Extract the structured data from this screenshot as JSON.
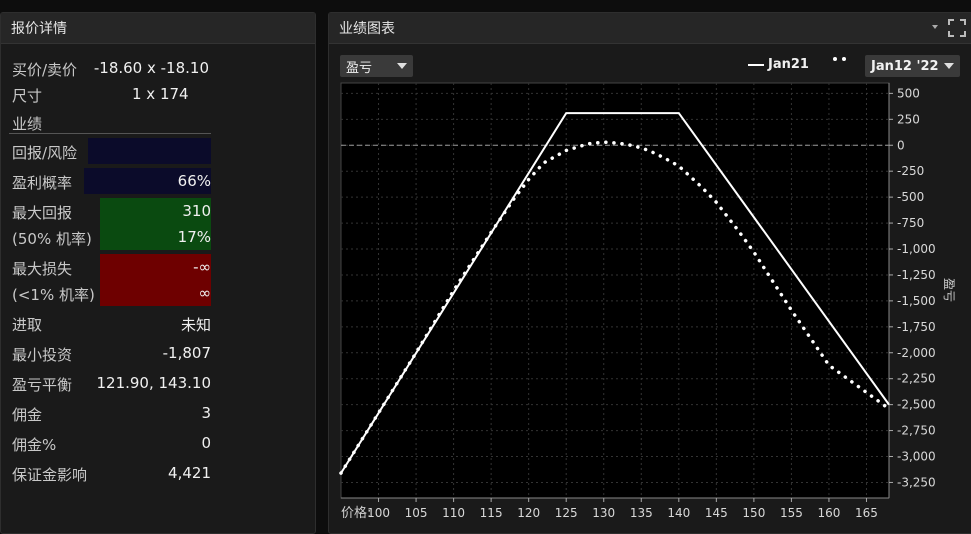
{
  "left": {
    "title": "报价详情",
    "bid_ask_label": "买价/卖价",
    "bid_ask_value": "-18.60 x -18.10",
    "size_label": "尺寸",
    "size_value": "1 x 174",
    "section_label": "业绩",
    "return_risk_label": "回报/风险",
    "prob_profit_label": "盈利概率",
    "prob_profit_value": "66%",
    "max_return_label": "最大回报",
    "max_return_value": "310",
    "max_return_prob_label": "(50% 机率)",
    "max_return_prob_value": "17%",
    "max_loss_label": "最大损失",
    "max_loss_value": "-∞",
    "max_loss_prob_label": "(<1% 机率)",
    "max_loss_prob_value": "∞",
    "aggr_label": "进取",
    "aggr_value": "未知",
    "min_invest_label": "最小投资",
    "min_invest_value": "-1,807",
    "breakeven_label": "盈亏平衡",
    "breakeven_value": "121.90, 143.10",
    "commission_label": "佣金",
    "commission_value": "3",
    "commission_pct_label": "佣金%",
    "commission_pct_value": "0",
    "margin_label": "保证金影响",
    "margin_value": "4,421"
  },
  "right": {
    "title": "业绩图表",
    "metric_dropdown": "盈亏",
    "legend_solid": "Jan21",
    "legend_dotted_dropdown": "Jan12 '22",
    "y_axis_label": "盈亏",
    "x_axis_prefix": "价格:"
  },
  "colors": {
    "return_risk_bg": "#0b0b2a",
    "prob_bg": "#0b0b2a",
    "max_return_bg": "#0a4a10",
    "max_loss_bg": "#6e0000"
  },
  "icons": {
    "menu": "dropdown-caret-icon",
    "expand": "expand-icon"
  },
  "chart_data": {
    "type": "line",
    "title": "",
    "xlabel": "价格:",
    "ylabel": "盈亏",
    "xlim": [
      95,
      168
    ],
    "ylim": [
      -3400,
      600
    ],
    "x_ticks": [
      100,
      105,
      110,
      115,
      120,
      125,
      130,
      135,
      140,
      145,
      150,
      155,
      160,
      165
    ],
    "y_ticks": [
      500,
      250,
      0,
      -250,
      -500,
      -750,
      -1000,
      -1250,
      -1500,
      -1750,
      -2000,
      -2250,
      -2500,
      -2750,
      -3000,
      -3250
    ],
    "y_tick_labels": [
      "500",
      "250",
      "0",
      "-250",
      "-500",
      "-750",
      "-1,000",
      "-1,250",
      "-1,500",
      "-1,750",
      "-2,000",
      "-2,250",
      "-2,500",
      "-2,750",
      "-3,000",
      "-3,250"
    ],
    "grid": true,
    "series": [
      {
        "name": "Jan21",
        "style": "solid",
        "x": [
          95,
          125,
          140,
          168
        ],
        "y": [
          -3160,
          310,
          310,
          -2500
        ]
      },
      {
        "name": "Jan12 '22",
        "style": "dotted",
        "x": [
          95,
          105,
          110,
          115,
          118,
          120,
          122,
          125,
          128,
          130,
          132,
          134,
          136,
          138,
          140,
          143,
          145,
          148,
          150,
          155,
          160,
          168
        ],
        "y": [
          -3160,
          -2000,
          -1400,
          -840,
          -520,
          -330,
          -170,
          -50,
          15,
          30,
          20,
          -5,
          -50,
          -120,
          -200,
          -400,
          -550,
          -830,
          -1030,
          -1590,
          -2120,
          -2540
        ]
      }
    ]
  }
}
